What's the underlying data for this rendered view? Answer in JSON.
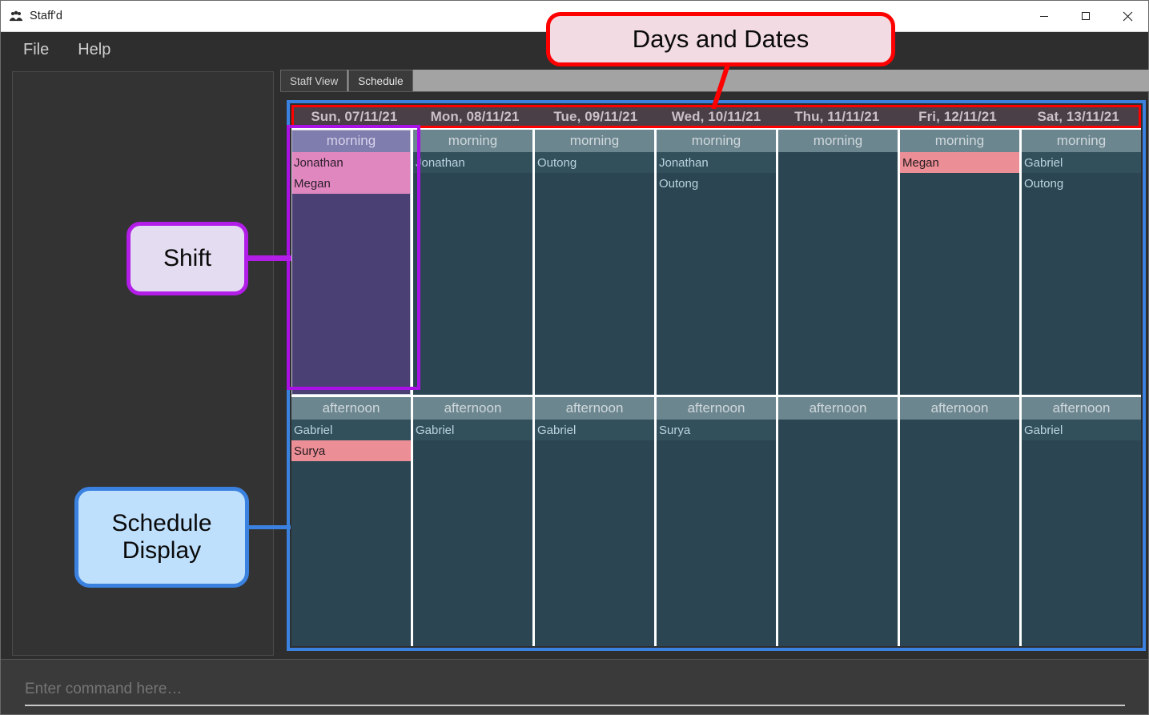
{
  "window": {
    "title": "Staff'd",
    "icon": "people-group-icon",
    "controls": {
      "minimize": "minimize-icon",
      "maximize": "maximize-icon",
      "close": "close-icon"
    }
  },
  "menubar": {
    "items": [
      {
        "label": "File"
      },
      {
        "label": "Help"
      }
    ]
  },
  "tabs": [
    {
      "label": "Staff View",
      "active": false
    },
    {
      "label": "Schedule",
      "active": true
    }
  ],
  "schedule": {
    "days": [
      "Sun, 07/11/21",
      "Mon, 08/11/21",
      "Tue, 09/11/21",
      "Wed, 10/11/21",
      "Thu, 11/11/21",
      "Fri, 12/11/21",
      "Sat, 13/11/21"
    ],
    "rows": [
      {
        "shift": "morning",
        "cells": [
          {
            "day": "Sun, 07/11/21",
            "selected": true,
            "names": [
              {
                "name": "Jonathan",
                "highlight": false
              },
              {
                "name": "Megan",
                "highlight": false
              }
            ]
          },
          {
            "day": "Mon, 08/11/21",
            "selected": false,
            "names": [
              {
                "name": "Jonathan",
                "highlight": false
              }
            ]
          },
          {
            "day": "Tue, 09/11/21",
            "selected": false,
            "names": [
              {
                "name": "Outong",
                "highlight": false
              }
            ]
          },
          {
            "day": "Wed, 10/11/21",
            "selected": false,
            "names": [
              {
                "name": "Jonathan",
                "highlight": false
              },
              {
                "name": "Outong",
                "highlight": false
              }
            ]
          },
          {
            "day": "Thu, 11/11/21",
            "selected": false,
            "names": []
          },
          {
            "day": "Fri, 12/11/21",
            "selected": false,
            "names": [
              {
                "name": "Megan",
                "highlight": true
              }
            ]
          },
          {
            "day": "Sat, 13/11/21",
            "selected": false,
            "names": [
              {
                "name": "Gabriel",
                "highlight": false
              },
              {
                "name": "Outong",
                "highlight": false
              }
            ]
          }
        ]
      },
      {
        "shift": "afternoon",
        "cells": [
          {
            "day": "Sun, 07/11/21",
            "selected": false,
            "names": [
              {
                "name": "Gabriel",
                "highlight": false
              },
              {
                "name": "Surya",
                "highlight": true
              }
            ]
          },
          {
            "day": "Mon, 08/11/21",
            "selected": false,
            "names": [
              {
                "name": "Gabriel",
                "highlight": false
              }
            ]
          },
          {
            "day": "Tue, 09/11/21",
            "selected": false,
            "names": [
              {
                "name": "Gabriel",
                "highlight": false
              }
            ]
          },
          {
            "day": "Wed, 10/11/21",
            "selected": false,
            "names": [
              {
                "name": "Surya",
                "highlight": false
              }
            ]
          },
          {
            "day": "Thu, 11/11/21",
            "selected": false,
            "names": []
          },
          {
            "day": "Fri, 12/11/21",
            "selected": false,
            "names": []
          },
          {
            "day": "Sat, 13/11/21",
            "selected": false,
            "names": [
              {
                "name": "Gabriel",
                "highlight": false
              }
            ]
          }
        ]
      }
    ]
  },
  "command": {
    "value": "",
    "placeholder": "Enter command here…"
  },
  "annotations": [
    {
      "id": "days-and-dates",
      "text": "Days and Dates",
      "border_color": "#ff0000",
      "fill_color": "#f2dbe3"
    },
    {
      "id": "shift",
      "text": "Shift",
      "border_color": "#b21ee8",
      "fill_color": "#e4dcf0"
    },
    {
      "id": "schedule-display",
      "text": "Schedule\nDisplay",
      "border_color": "#3b82e0",
      "fill_color": "#bfe0fd"
    }
  ],
  "colors": {
    "window_bg": "#2e2e2e",
    "shift_header": "#6c868f",
    "shift_body": "#2b4652",
    "day_header": "#4a3f47",
    "selected_body": "#4a4073",
    "selected_header": "#7f7cae",
    "selected_name": "#e187c0",
    "conflict_name": "#ec8e96"
  }
}
